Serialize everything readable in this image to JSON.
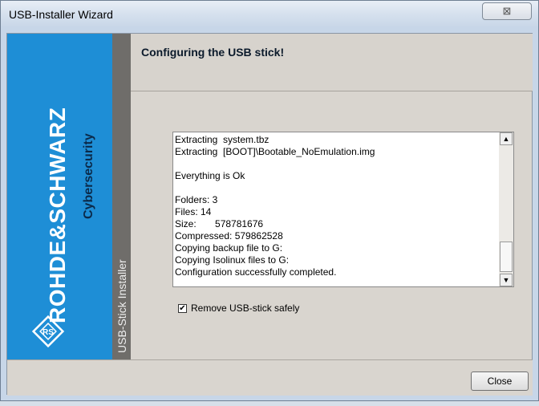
{
  "window": {
    "title": "USB-Installer Wizard",
    "close_glyph": "⊠"
  },
  "brand": {
    "name": "ROHDE&SCHWARZ",
    "sub": "Cybersecurity",
    "logo_letters": "RS",
    "strip_label": "USB-Stick Installer"
  },
  "header": {
    "title": "Configuring the USB stick!"
  },
  "log": {
    "lines": [
      "Extracting  system.tbz",
      "Extracting  [BOOT]\\Bootable_NoEmulation.img",
      "",
      "Everything is Ok",
      "",
      "Folders: 3",
      "Files: 14",
      "Size:       578781676",
      "Compressed: 579862528",
      "Copying backup file to G:",
      "Copying Isolinux files to G:",
      "Configuration successfully completed."
    ]
  },
  "checkbox": {
    "label": "Remove USB-stick safely",
    "checked": true
  },
  "footer": {
    "close_label": "Close"
  }
}
